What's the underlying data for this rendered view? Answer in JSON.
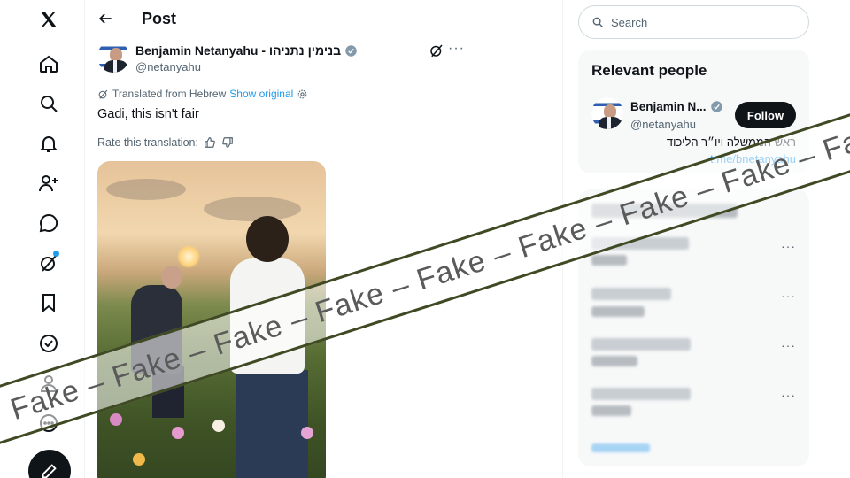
{
  "nav": {
    "items": [
      {
        "name": "x-logo-icon"
      },
      {
        "name": "home-icon"
      },
      {
        "name": "search-icon"
      },
      {
        "name": "notifications-icon"
      },
      {
        "name": "follow-icon"
      },
      {
        "name": "messages-icon"
      },
      {
        "name": "grok-icon"
      },
      {
        "name": "bookmarks-icon"
      },
      {
        "name": "verified-icon"
      },
      {
        "name": "profile-icon"
      },
      {
        "name": "more-icon"
      }
    ],
    "compose_icon": "compose-icon"
  },
  "header": {
    "title": "Post"
  },
  "post": {
    "author_name": "Benjamin Netanyahu - בנימין נתניהו",
    "author_handle": "@netanyahu",
    "translated_label": "Translated from Hebrew",
    "show_original": "Show original",
    "text": "Gadi, this isn't fair",
    "rate_label": "Rate this translation:"
  },
  "search": {
    "placeholder": "Search"
  },
  "relevant_people": {
    "title": "Relevant people",
    "name": "Benjamin N...",
    "handle": "@netanyahu",
    "follow_label": "Follow",
    "bio": "ראש הממשלה ויו״ר הליכוד",
    "link": "t.me/bnetanyahu"
  },
  "watermark": {
    "text": "Fake – Fake – Fake – Fake – Fake – Fake – Fake – Fake – Fake –"
  },
  "colors": {
    "accent": "#1d9bf0",
    "text": "#0f1419",
    "muted": "#536471",
    "banner_border": "#3f4a24"
  }
}
